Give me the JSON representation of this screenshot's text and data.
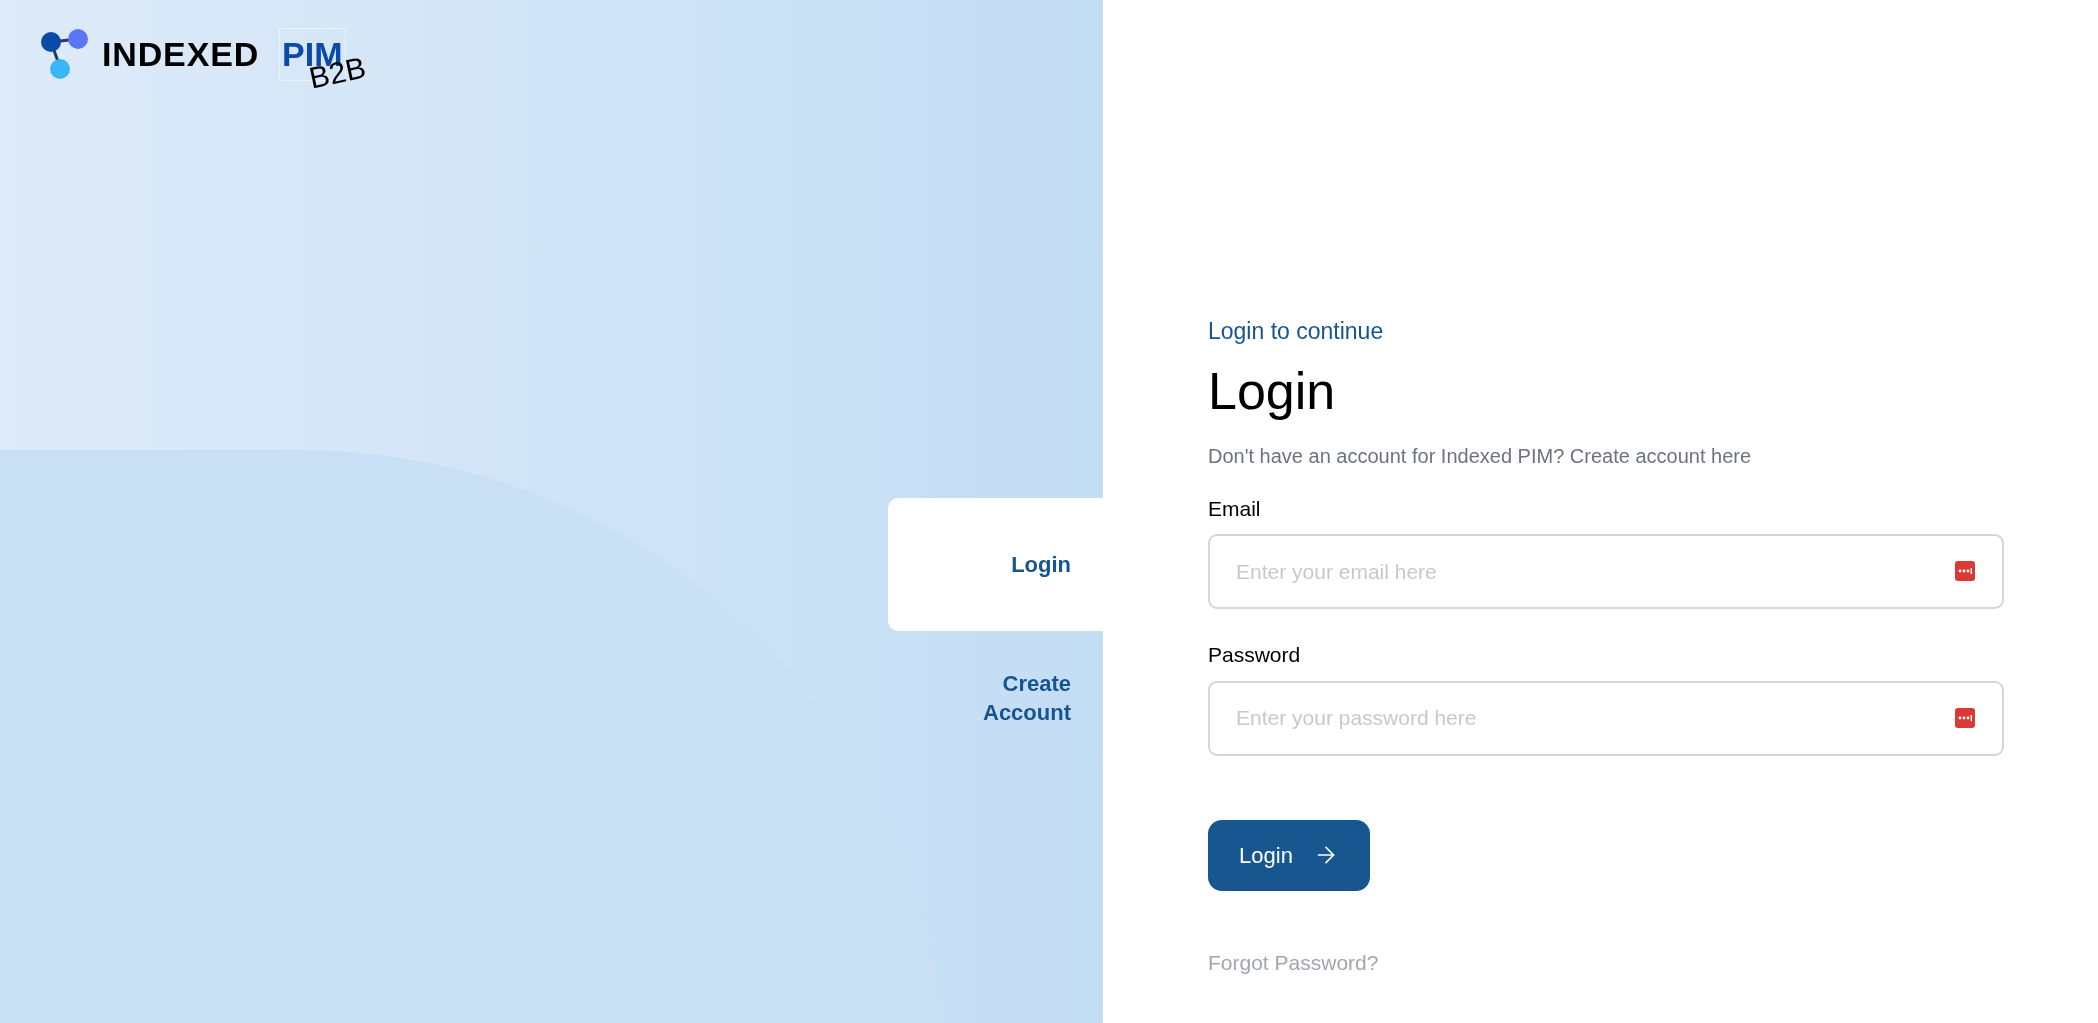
{
  "logo": {
    "wordmark": "INDEXED",
    "product": "PIM",
    "edition": "B2B"
  },
  "tabs": [
    {
      "label": "Login",
      "selected": true
    },
    {
      "label": "Create Account",
      "selected": false
    }
  ],
  "form": {
    "eyebrow": "Login to continue",
    "title": "Login",
    "subtitle": "Don't have an account for Indexed PIM? Create account here",
    "fields": [
      {
        "label": "Email",
        "placeholder": "Enter your email here"
      },
      {
        "label": "Password",
        "placeholder": "Enter your password here"
      }
    ],
    "submit": "Login",
    "forgot": "Forgot Password?"
  }
}
